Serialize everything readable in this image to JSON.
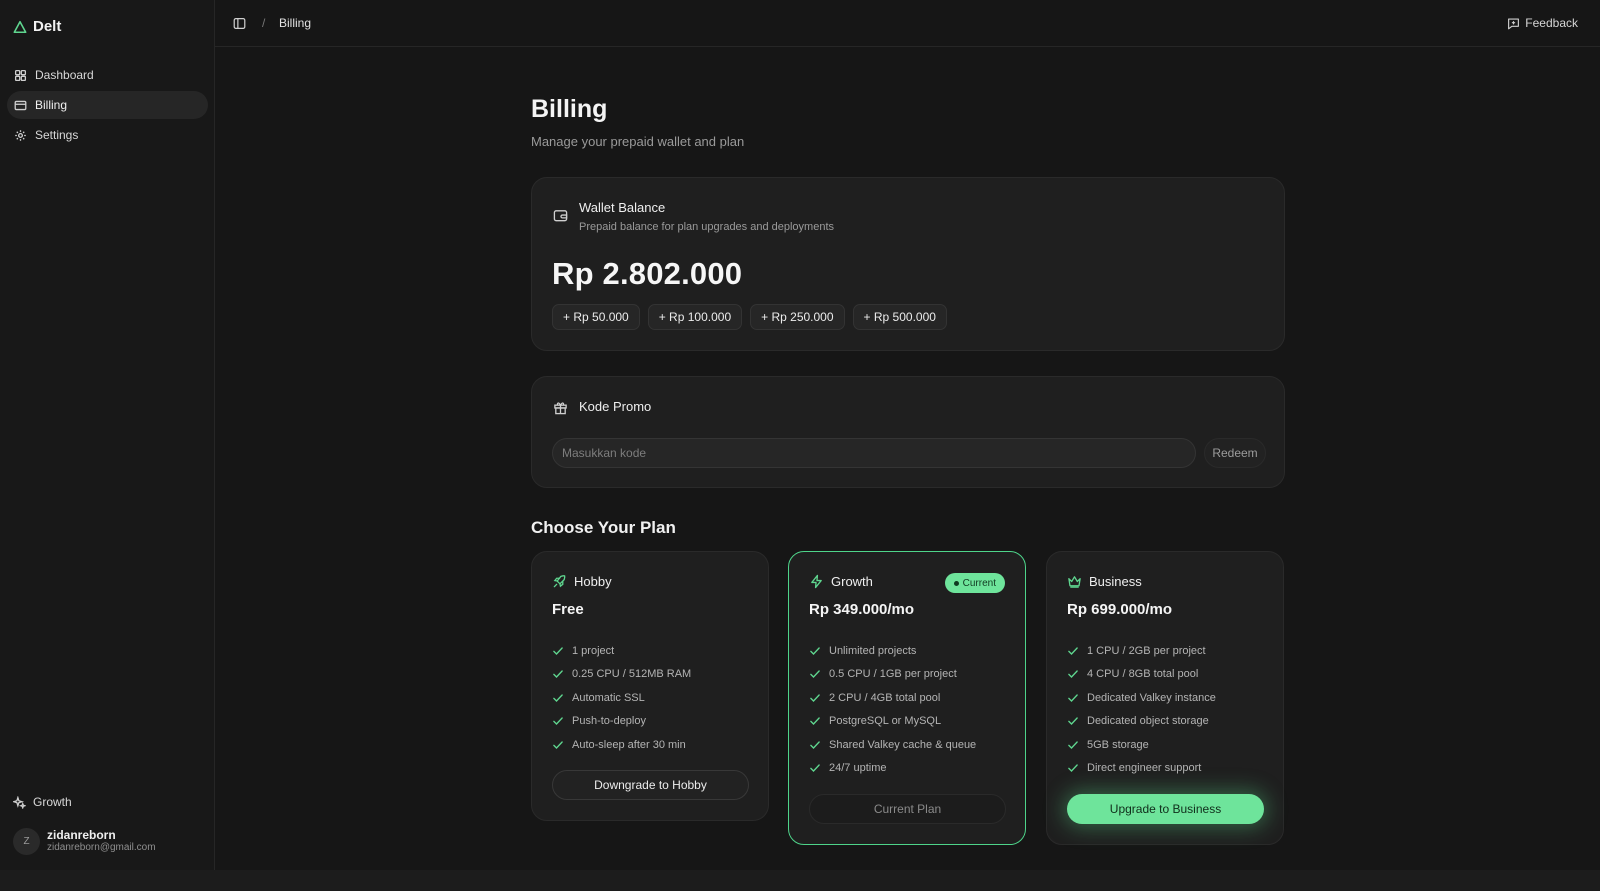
{
  "app": {
    "name": "Delt"
  },
  "sidebar": {
    "items": [
      {
        "label": "Dashboard",
        "icon": "dashboard-icon"
      },
      {
        "label": "Billing",
        "icon": "card-icon",
        "active": true
      },
      {
        "label": "Settings",
        "icon": "gear-icon"
      }
    ],
    "plan_label": "Growth",
    "user": {
      "initial": "Z",
      "name": "zidanreborn",
      "email": "zidanreborn@gmail.com"
    }
  },
  "header": {
    "breadcrumb_separator": "/",
    "breadcrumb": "Billing",
    "feedback_label": "Feedback"
  },
  "page": {
    "title": "Billing",
    "subtitle": "Manage your prepaid wallet and plan"
  },
  "wallet": {
    "title": "Wallet Balance",
    "description": "Prepaid balance for plan upgrades and deployments",
    "balance": "Rp 2.802.000",
    "topups": [
      "+ Rp 50.000",
      "+ Rp 100.000",
      "+ Rp 250.000",
      "+ Rp 500.000"
    ]
  },
  "promo": {
    "title": "Kode Promo",
    "placeholder": "Masukkan kode",
    "redeem_label": "Redeem"
  },
  "plans": {
    "section_title": "Choose Your Plan",
    "hobby": {
      "name": "Hobby",
      "price": "Free",
      "features": [
        "1 project",
        "0.25 CPU / 512MB RAM",
        "Automatic SSL",
        "Push-to-deploy",
        "Auto-sleep after 30 min"
      ],
      "button": "Downgrade to Hobby"
    },
    "growth": {
      "name": "Growth",
      "badge": "Current",
      "price": "Rp 349.000/mo",
      "features": [
        "Unlimited projects",
        "0.5 CPU / 1GB per project",
        "2 CPU / 4GB total pool",
        "PostgreSQL or MySQL",
        "Shared Valkey cache & queue",
        "24/7 uptime"
      ],
      "button": "Current Plan"
    },
    "business": {
      "name": "Business",
      "price": "Rp 699.000/mo",
      "features": [
        "1 CPU / 2GB per project",
        "4 CPU / 8GB total pool",
        "Dedicated Valkey instance",
        "Dedicated object storage",
        "5GB storage",
        "Direct engineer support"
      ],
      "button": "Upgrade to Business"
    }
  },
  "colors": {
    "accent": "#6ee49b",
    "background": "#161616",
    "card": "#1f1f1f"
  }
}
